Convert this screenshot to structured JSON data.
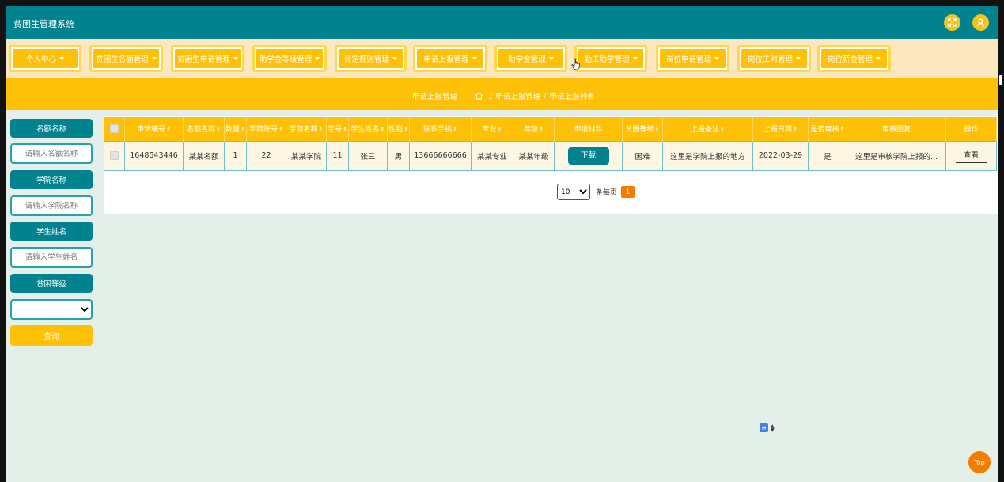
{
  "app": {
    "title": "贫困生管理系统",
    "fullscreen_icon": "fullscreen-icon",
    "user_icon": "user-icon"
  },
  "nav": {
    "items": [
      {
        "label": "个人中心"
      },
      {
        "label": "贫困生名额管理"
      },
      {
        "label": "贫困生申请管理"
      },
      {
        "label": "助学金等级管理"
      },
      {
        "label": "评定规则管理"
      },
      {
        "label": "申请上报管理"
      },
      {
        "label": "助学金管理"
      },
      {
        "label": "勤工助学管理"
      },
      {
        "label": "岗位申请管理"
      },
      {
        "label": "岗位工时管理"
      },
      {
        "label": "岗位薪金管理"
      }
    ]
  },
  "breadcrumb": {
    "title": "申请上报管理",
    "home_icon": "home-icon",
    "path": [
      "申请上报管理",
      "申请上报列表"
    ],
    "separator": "/"
  },
  "search": {
    "fields": [
      {
        "label": "名额名称",
        "placeholder": "请输入名额名称"
      },
      {
        "label": "学院名称",
        "placeholder": "请输入学院名称"
      },
      {
        "label": "学生姓名",
        "placeholder": "请输入学生姓名"
      }
    ],
    "level_label": "贫困等级",
    "level_value": "",
    "button": "查询"
  },
  "table": {
    "sort_icon": "⇕",
    "columns": [
      "申请编号",
      "名额名称",
      "数量",
      "学院账号",
      "学院名称",
      "学号",
      "学生姓名",
      "性别",
      "联系手机",
      "专业",
      "年级",
      "申请材料",
      "贫困等级",
      "上报备注",
      "上报日期",
      "是否审核",
      "审核回复",
      "操作"
    ],
    "rows": [
      {
        "id": "1648543446",
        "quota_name": "某某名额",
        "quantity": "1",
        "college_account": "22",
        "college_name": "某某学院",
        "student_no": "11",
        "student_name": "张三",
        "gender": "男",
        "phone": "13666666666",
        "major": "某某专业",
        "grade": "某某年级",
        "download": "下载",
        "poverty_level": "困难",
        "report_note": "这里是学院上报的地方",
        "report_date": "2022-03-29",
        "reviewed": "是",
        "review_reply": "这里是审核学院上报的...",
        "action": "查看"
      }
    ]
  },
  "pagination": {
    "page_size": "10",
    "page_size_options": [
      "10"
    ],
    "per_page_text": "条每页",
    "current_page": "1"
  },
  "widgets": {
    "back_to_top": "Top"
  },
  "colors": {
    "primary": "#00838f",
    "accent": "#ffc107",
    "nav_bg": "#fce8c0",
    "page_bg": "#e4efe9",
    "orange": "#f57c00"
  }
}
